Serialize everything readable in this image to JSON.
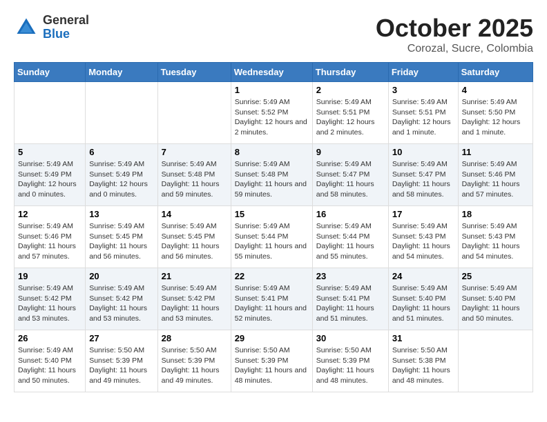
{
  "header": {
    "logo_general": "General",
    "logo_blue": "Blue",
    "title": "October 2025",
    "subtitle": "Corozal, Sucre, Colombia"
  },
  "days_of_week": [
    "Sunday",
    "Monday",
    "Tuesday",
    "Wednesday",
    "Thursday",
    "Friday",
    "Saturday"
  ],
  "weeks": [
    [
      {
        "day": "",
        "info": ""
      },
      {
        "day": "",
        "info": ""
      },
      {
        "day": "",
        "info": ""
      },
      {
        "day": "1",
        "info": "Sunrise: 5:49 AM\nSunset: 5:52 PM\nDaylight: 12 hours and 2 minutes."
      },
      {
        "day": "2",
        "info": "Sunrise: 5:49 AM\nSunset: 5:51 PM\nDaylight: 12 hours and 2 minutes."
      },
      {
        "day": "3",
        "info": "Sunrise: 5:49 AM\nSunset: 5:51 PM\nDaylight: 12 hours and 1 minute."
      },
      {
        "day": "4",
        "info": "Sunrise: 5:49 AM\nSunset: 5:50 PM\nDaylight: 12 hours and 1 minute."
      }
    ],
    [
      {
        "day": "5",
        "info": "Sunrise: 5:49 AM\nSunset: 5:49 PM\nDaylight: 12 hours and 0 minutes."
      },
      {
        "day": "6",
        "info": "Sunrise: 5:49 AM\nSunset: 5:49 PM\nDaylight: 12 hours and 0 minutes."
      },
      {
        "day": "7",
        "info": "Sunrise: 5:49 AM\nSunset: 5:48 PM\nDaylight: 11 hours and 59 minutes."
      },
      {
        "day": "8",
        "info": "Sunrise: 5:49 AM\nSunset: 5:48 PM\nDaylight: 11 hours and 59 minutes."
      },
      {
        "day": "9",
        "info": "Sunrise: 5:49 AM\nSunset: 5:47 PM\nDaylight: 11 hours and 58 minutes."
      },
      {
        "day": "10",
        "info": "Sunrise: 5:49 AM\nSunset: 5:47 PM\nDaylight: 11 hours and 58 minutes."
      },
      {
        "day": "11",
        "info": "Sunrise: 5:49 AM\nSunset: 5:46 PM\nDaylight: 11 hours and 57 minutes."
      }
    ],
    [
      {
        "day": "12",
        "info": "Sunrise: 5:49 AM\nSunset: 5:46 PM\nDaylight: 11 hours and 57 minutes."
      },
      {
        "day": "13",
        "info": "Sunrise: 5:49 AM\nSunset: 5:45 PM\nDaylight: 11 hours and 56 minutes."
      },
      {
        "day": "14",
        "info": "Sunrise: 5:49 AM\nSunset: 5:45 PM\nDaylight: 11 hours and 56 minutes."
      },
      {
        "day": "15",
        "info": "Sunrise: 5:49 AM\nSunset: 5:44 PM\nDaylight: 11 hours and 55 minutes."
      },
      {
        "day": "16",
        "info": "Sunrise: 5:49 AM\nSunset: 5:44 PM\nDaylight: 11 hours and 55 minutes."
      },
      {
        "day": "17",
        "info": "Sunrise: 5:49 AM\nSunset: 5:43 PM\nDaylight: 11 hours and 54 minutes."
      },
      {
        "day": "18",
        "info": "Sunrise: 5:49 AM\nSunset: 5:43 PM\nDaylight: 11 hours and 54 minutes."
      }
    ],
    [
      {
        "day": "19",
        "info": "Sunrise: 5:49 AM\nSunset: 5:42 PM\nDaylight: 11 hours and 53 minutes."
      },
      {
        "day": "20",
        "info": "Sunrise: 5:49 AM\nSunset: 5:42 PM\nDaylight: 11 hours and 53 minutes."
      },
      {
        "day": "21",
        "info": "Sunrise: 5:49 AM\nSunset: 5:42 PM\nDaylight: 11 hours and 53 minutes."
      },
      {
        "day": "22",
        "info": "Sunrise: 5:49 AM\nSunset: 5:41 PM\nDaylight: 11 hours and 52 minutes."
      },
      {
        "day": "23",
        "info": "Sunrise: 5:49 AM\nSunset: 5:41 PM\nDaylight: 11 hours and 51 minutes."
      },
      {
        "day": "24",
        "info": "Sunrise: 5:49 AM\nSunset: 5:40 PM\nDaylight: 11 hours and 51 minutes."
      },
      {
        "day": "25",
        "info": "Sunrise: 5:49 AM\nSunset: 5:40 PM\nDaylight: 11 hours and 50 minutes."
      }
    ],
    [
      {
        "day": "26",
        "info": "Sunrise: 5:49 AM\nSunset: 5:40 PM\nDaylight: 11 hours and 50 minutes."
      },
      {
        "day": "27",
        "info": "Sunrise: 5:50 AM\nSunset: 5:39 PM\nDaylight: 11 hours and 49 minutes."
      },
      {
        "day": "28",
        "info": "Sunrise: 5:50 AM\nSunset: 5:39 PM\nDaylight: 11 hours and 49 minutes."
      },
      {
        "day": "29",
        "info": "Sunrise: 5:50 AM\nSunset: 5:39 PM\nDaylight: 11 hours and 48 minutes."
      },
      {
        "day": "30",
        "info": "Sunrise: 5:50 AM\nSunset: 5:39 PM\nDaylight: 11 hours and 48 minutes."
      },
      {
        "day": "31",
        "info": "Sunrise: 5:50 AM\nSunset: 5:38 PM\nDaylight: 11 hours and 48 minutes."
      },
      {
        "day": "",
        "info": ""
      }
    ]
  ]
}
